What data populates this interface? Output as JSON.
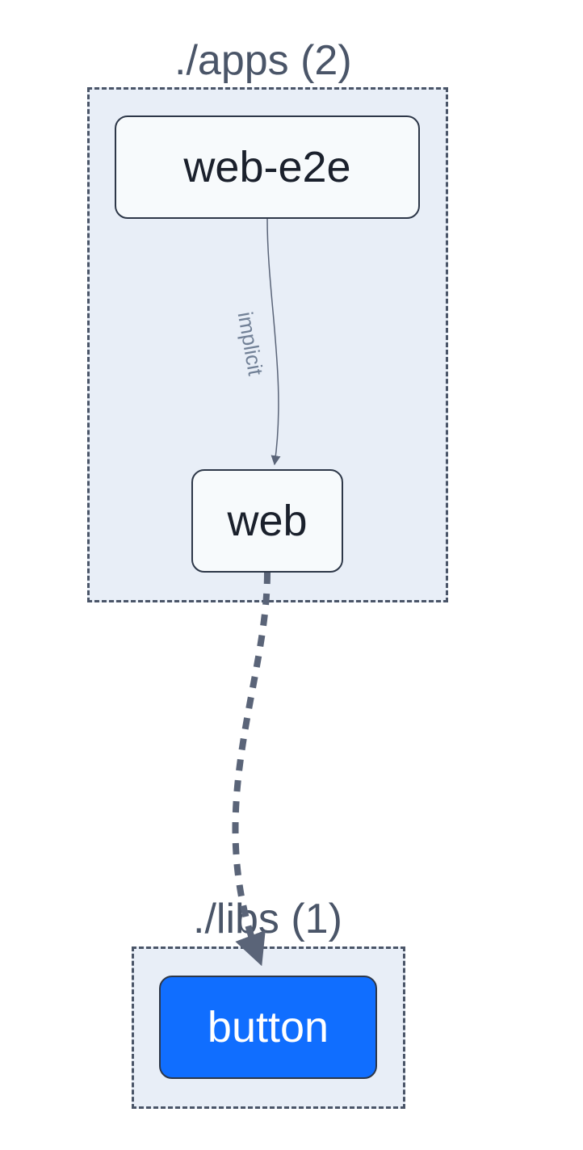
{
  "groups": {
    "apps": {
      "label": "./apps (2)",
      "count": 2
    },
    "libs": {
      "label": "./libs (1)",
      "count": 1
    }
  },
  "nodes": {
    "web_e2e": {
      "label": "web-e2e",
      "group": "apps",
      "selected": false
    },
    "web": {
      "label": "web",
      "group": "apps",
      "selected": false
    },
    "button": {
      "label": "button",
      "group": "libs",
      "selected": true
    }
  },
  "edges": {
    "web_e2e_to_web": {
      "from": "web_e2e",
      "to": "web",
      "label": "implicit",
      "style": "solid-thin"
    },
    "web_to_button": {
      "from": "web",
      "to": "button",
      "style": "dashed-thick"
    }
  },
  "colors": {
    "group_border": "#4a5568",
    "group_bg": "#e8eef7",
    "node_bg": "#f7fafc",
    "node_border": "#2d3748",
    "node_text": "#1a202c",
    "selected_bg": "#106eff",
    "selected_text": "#ffffff",
    "edge_color": "#5a6478",
    "edge_label_color": "#718096"
  }
}
